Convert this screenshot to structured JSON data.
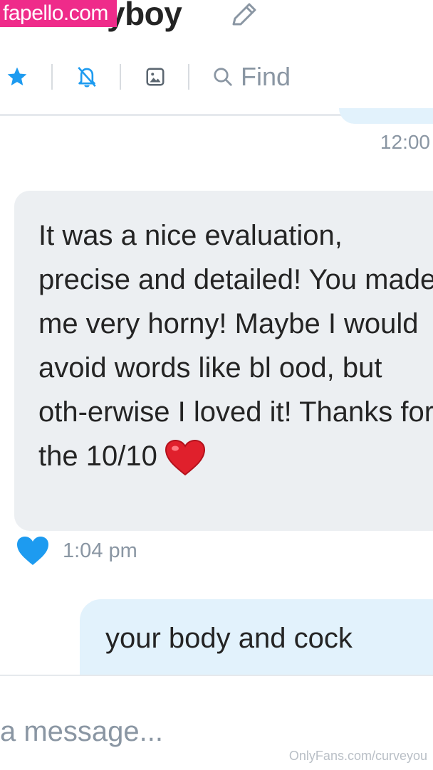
{
  "header": {
    "watermark": "fapello.com",
    "title_visible": "yboy",
    "edit_icon": "pencil-icon",
    "toolbar": {
      "star_icon": "star-icon",
      "mute_icon": "bell-off-icon",
      "media_icon": "image-icon",
      "search_icon": "search-icon",
      "find_label": "Find"
    }
  },
  "messages": [
    {
      "direction": "outgoing",
      "time": "12:00"
    },
    {
      "direction": "incoming",
      "text": "It was a nice evaluation, precise and detailed! You made me very horny! Maybe I would avoid words like bl ood, but oth-erwise I loved it! Thanks for the 10/10",
      "emoji": "❤️",
      "time": "1:04 pm",
      "liked": true
    },
    {
      "direction": "outgoing",
      "text": "your body and cock"
    }
  ],
  "composer": {
    "placeholder": "a message..."
  },
  "credit": "OnlyFans.com/curveyou",
  "colors": {
    "accent": "#1d9bf0",
    "incoming_bubble": "#eceff2",
    "outgoing_bubble": "#e2f2fc",
    "muted_text": "#8a96a3",
    "watermark": "#ef2b8a"
  }
}
